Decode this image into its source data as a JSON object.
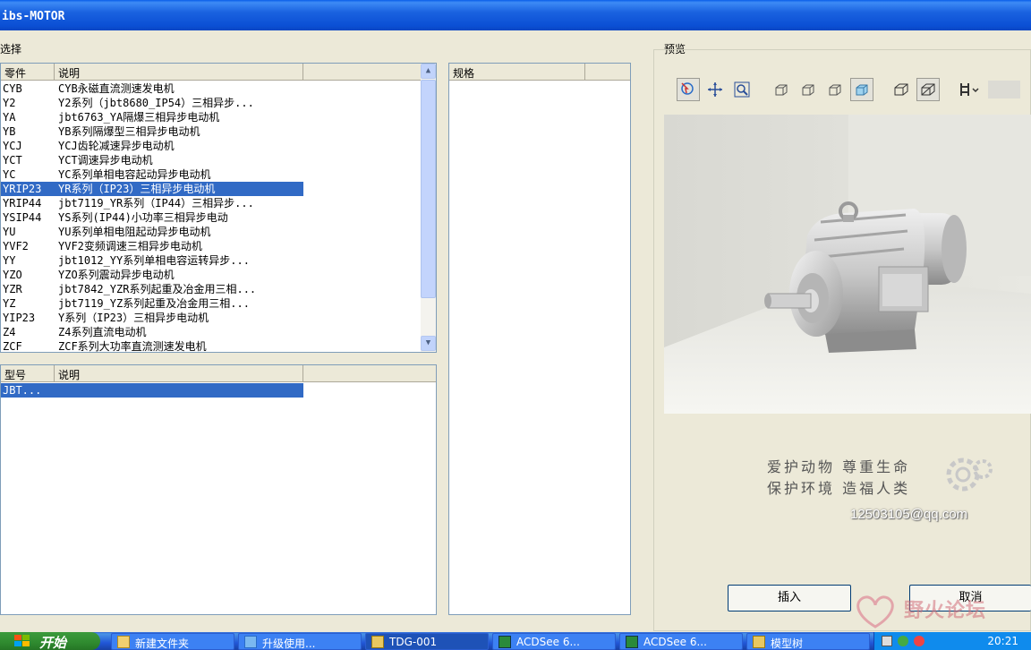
{
  "window": {
    "title": "ibs-MOTOR"
  },
  "select_group": {
    "label": "选择"
  },
  "preview_group": {
    "label": "预览"
  },
  "parts_list": {
    "headers": [
      "零件",
      "说明"
    ],
    "rows": [
      [
        "CYB",
        "CYB永磁直流测速发电机"
      ],
      [
        "Y2",
        "Y2系列（jbt8680_IP54）三相异步..."
      ],
      [
        "YA",
        "jbt6763_YA隔爆三相异步电动机"
      ],
      [
        "YB",
        "YB系列隔爆型三相异步电动机"
      ],
      [
        "YCJ",
        "YCJ齿轮减速异步电动机"
      ],
      [
        "YCT",
        "YCT调速异步电动机"
      ],
      [
        "YC",
        "YC系列单相电容起动异步电动机"
      ],
      [
        "YRIP23",
        "YR系列（IP23）三相异步电动机"
      ],
      [
        "YRIP44",
        "jbt7119_YR系列（IP44）三相异步..."
      ],
      [
        "YSIP44",
        "YS系列(IP44)小功率三相异步电动"
      ],
      [
        "YU",
        "YU系列单相电阻起动异步电动机"
      ],
      [
        "YVF2",
        "YVF2变频调速三相异步电动机"
      ],
      [
        "YY",
        "jbt1012_YY系列单相电容运转异步..."
      ],
      [
        "YZO",
        "YZO系列震动异步电动机"
      ],
      [
        "YZR",
        "jbt7842_YZR系列起重及冶金用三相..."
      ],
      [
        "YZ",
        "jbt7119_YZ系列起重及冶金用三相..."
      ],
      [
        "YIP23",
        "Y系列（IP23）三相异步电动机"
      ],
      [
        "Z4",
        "Z4系列直流电动机"
      ],
      [
        "ZCF",
        "ZCF系列大功率直流测速发电机"
      ]
    ],
    "selected_index": 7
  },
  "model_list": {
    "headers": [
      "型号",
      "说明"
    ],
    "rows": [
      [
        "JBT...",
        ""
      ]
    ],
    "selected_index": 0
  },
  "spec_list": {
    "headers": [
      "规格"
    ]
  },
  "toolbar_icons": [
    "select-icon",
    "pan-icon",
    "zoom-icon",
    "view-front-icon",
    "view-side-icon",
    "view-top-icon",
    "view-iso-icon",
    "wireframe-icon",
    "shaded-icon",
    "dimension-icon"
  ],
  "slogan": {
    "line1": "爱护动物 尊重生命",
    "line2": "保护环境 造福人类"
  },
  "email": "12503105@qq.com",
  "buttons": {
    "insert": "插入",
    "cancel": "取消"
  },
  "watermark": "野火论坛",
  "taskbar": {
    "start": "开始",
    "tasks": [
      "新建文件夹",
      "升级使用...",
      "TDG-001",
      "ACDSee 6...",
      "ACDSee 6...",
      "模型树"
    ],
    "active_task": 2,
    "clock": "20:21"
  }
}
